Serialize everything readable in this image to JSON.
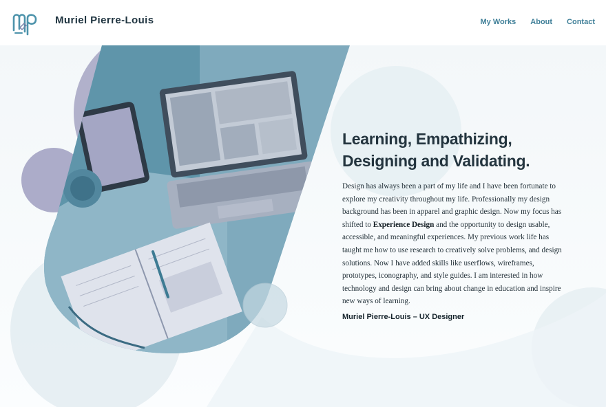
{
  "brand": {
    "logo_text": "mp",
    "name": "Muriel Pierre-Louis"
  },
  "nav": {
    "items": [
      "My Works",
      "About",
      "Contact"
    ]
  },
  "hero": {
    "headline_line1": "Learning, Empathizing,",
    "headline_line2": "Designing and Validating.",
    "paragraph_before": "Design has always been a part of my life and I have been fortunate to explore my creativity throughout my life. Professionally my design background has been in apparel and graphic design. Now my focus has shifted to ",
    "paragraph_emphasis": "Experience Design",
    "paragraph_after": " and the opportunity to design usable, accessible, and meaningful experiences. My previous work life has taught me how to use research to creatively solve problems, and design solutions. Now I have added skills like userflows, wireframes, prototypes, iconography, and style guides. I am interested in how technology and design can bring about change in education and inspire new ways of learning.",
    "signature": "Muriel Pierre-Louis – UX Designer"
  },
  "colors": {
    "accent": "#3f7f98",
    "teal": "#5b96ac",
    "lavender": "#a9a9c4",
    "pale_blue": "#dfeaf0"
  }
}
